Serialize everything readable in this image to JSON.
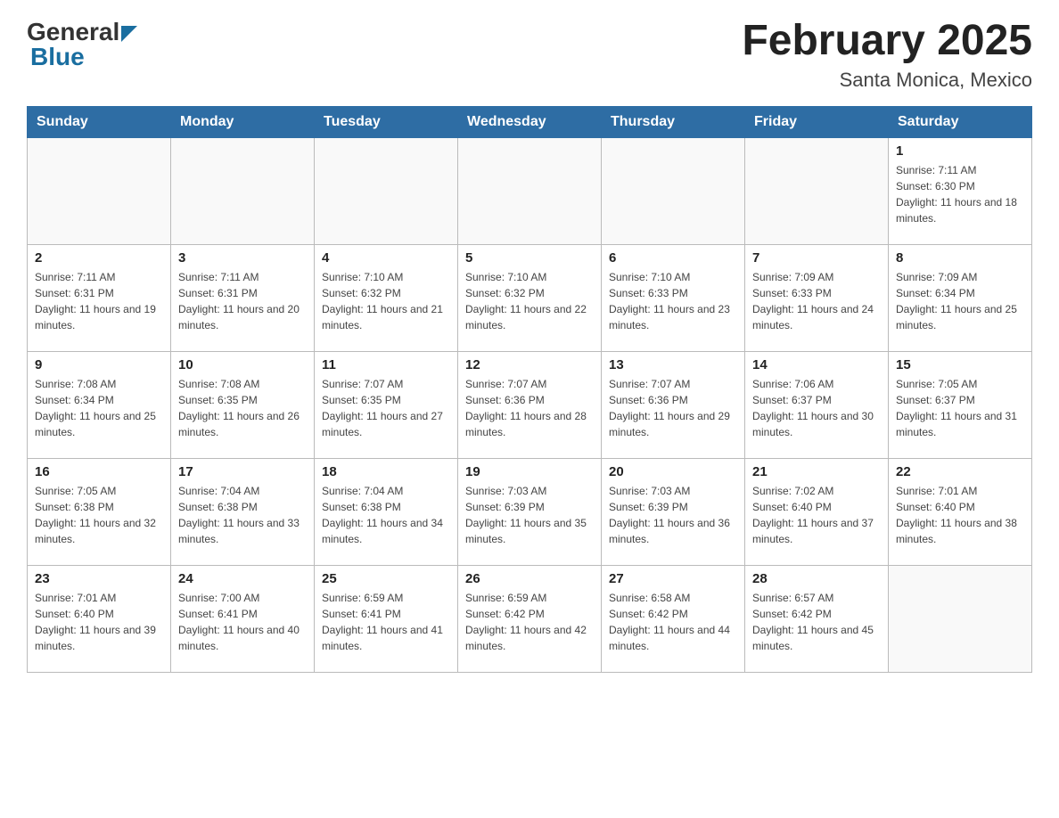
{
  "header": {
    "logo_general": "General",
    "logo_blue": "Blue",
    "title": "February 2025",
    "subtitle": "Santa Monica, Mexico"
  },
  "days_of_week": [
    "Sunday",
    "Monday",
    "Tuesday",
    "Wednesday",
    "Thursday",
    "Friday",
    "Saturday"
  ],
  "weeks": [
    {
      "days": [
        {
          "date": "",
          "info": ""
        },
        {
          "date": "",
          "info": ""
        },
        {
          "date": "",
          "info": ""
        },
        {
          "date": "",
          "info": ""
        },
        {
          "date": "",
          "info": ""
        },
        {
          "date": "",
          "info": ""
        },
        {
          "date": "1",
          "info": "Sunrise: 7:11 AM\nSunset: 6:30 PM\nDaylight: 11 hours and 18 minutes."
        }
      ]
    },
    {
      "days": [
        {
          "date": "2",
          "info": "Sunrise: 7:11 AM\nSunset: 6:31 PM\nDaylight: 11 hours and 19 minutes."
        },
        {
          "date": "3",
          "info": "Sunrise: 7:11 AM\nSunset: 6:31 PM\nDaylight: 11 hours and 20 minutes."
        },
        {
          "date": "4",
          "info": "Sunrise: 7:10 AM\nSunset: 6:32 PM\nDaylight: 11 hours and 21 minutes."
        },
        {
          "date": "5",
          "info": "Sunrise: 7:10 AM\nSunset: 6:32 PM\nDaylight: 11 hours and 22 minutes."
        },
        {
          "date": "6",
          "info": "Sunrise: 7:10 AM\nSunset: 6:33 PM\nDaylight: 11 hours and 23 minutes."
        },
        {
          "date": "7",
          "info": "Sunrise: 7:09 AM\nSunset: 6:33 PM\nDaylight: 11 hours and 24 minutes."
        },
        {
          "date": "8",
          "info": "Sunrise: 7:09 AM\nSunset: 6:34 PM\nDaylight: 11 hours and 25 minutes."
        }
      ]
    },
    {
      "days": [
        {
          "date": "9",
          "info": "Sunrise: 7:08 AM\nSunset: 6:34 PM\nDaylight: 11 hours and 25 minutes."
        },
        {
          "date": "10",
          "info": "Sunrise: 7:08 AM\nSunset: 6:35 PM\nDaylight: 11 hours and 26 minutes."
        },
        {
          "date": "11",
          "info": "Sunrise: 7:07 AM\nSunset: 6:35 PM\nDaylight: 11 hours and 27 minutes."
        },
        {
          "date": "12",
          "info": "Sunrise: 7:07 AM\nSunset: 6:36 PM\nDaylight: 11 hours and 28 minutes."
        },
        {
          "date": "13",
          "info": "Sunrise: 7:07 AM\nSunset: 6:36 PM\nDaylight: 11 hours and 29 minutes."
        },
        {
          "date": "14",
          "info": "Sunrise: 7:06 AM\nSunset: 6:37 PM\nDaylight: 11 hours and 30 minutes."
        },
        {
          "date": "15",
          "info": "Sunrise: 7:05 AM\nSunset: 6:37 PM\nDaylight: 11 hours and 31 minutes."
        }
      ]
    },
    {
      "days": [
        {
          "date": "16",
          "info": "Sunrise: 7:05 AM\nSunset: 6:38 PM\nDaylight: 11 hours and 32 minutes."
        },
        {
          "date": "17",
          "info": "Sunrise: 7:04 AM\nSunset: 6:38 PM\nDaylight: 11 hours and 33 minutes."
        },
        {
          "date": "18",
          "info": "Sunrise: 7:04 AM\nSunset: 6:38 PM\nDaylight: 11 hours and 34 minutes."
        },
        {
          "date": "19",
          "info": "Sunrise: 7:03 AM\nSunset: 6:39 PM\nDaylight: 11 hours and 35 minutes."
        },
        {
          "date": "20",
          "info": "Sunrise: 7:03 AM\nSunset: 6:39 PM\nDaylight: 11 hours and 36 minutes."
        },
        {
          "date": "21",
          "info": "Sunrise: 7:02 AM\nSunset: 6:40 PM\nDaylight: 11 hours and 37 minutes."
        },
        {
          "date": "22",
          "info": "Sunrise: 7:01 AM\nSunset: 6:40 PM\nDaylight: 11 hours and 38 minutes."
        }
      ]
    },
    {
      "days": [
        {
          "date": "23",
          "info": "Sunrise: 7:01 AM\nSunset: 6:40 PM\nDaylight: 11 hours and 39 minutes."
        },
        {
          "date": "24",
          "info": "Sunrise: 7:00 AM\nSunset: 6:41 PM\nDaylight: 11 hours and 40 minutes."
        },
        {
          "date": "25",
          "info": "Sunrise: 6:59 AM\nSunset: 6:41 PM\nDaylight: 11 hours and 41 minutes."
        },
        {
          "date": "26",
          "info": "Sunrise: 6:59 AM\nSunset: 6:42 PM\nDaylight: 11 hours and 42 minutes."
        },
        {
          "date": "27",
          "info": "Sunrise: 6:58 AM\nSunset: 6:42 PM\nDaylight: 11 hours and 44 minutes."
        },
        {
          "date": "28",
          "info": "Sunrise: 6:57 AM\nSunset: 6:42 PM\nDaylight: 11 hours and 45 minutes."
        },
        {
          "date": "",
          "info": ""
        }
      ]
    }
  ]
}
